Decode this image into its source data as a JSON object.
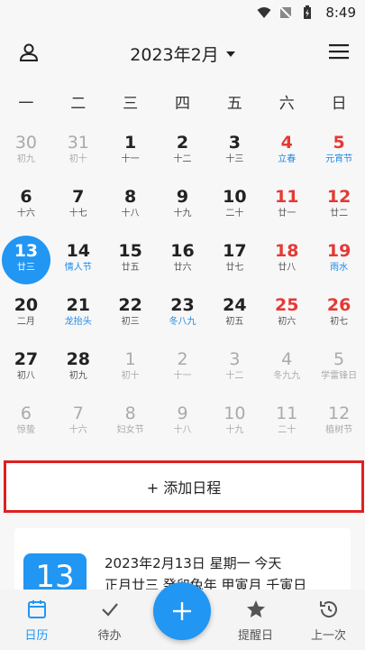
{
  "status": {
    "time": "8:49"
  },
  "header": {
    "title": "2023年2月"
  },
  "weekdays": [
    "一",
    "二",
    "三",
    "四",
    "五",
    "六",
    "日"
  ],
  "weeks": [
    [
      {
        "n": "30",
        "s": "初九",
        "t": "dim"
      },
      {
        "n": "31",
        "s": "初十",
        "t": "dim"
      },
      {
        "n": "1",
        "s": "十一",
        "t": ""
      },
      {
        "n": "2",
        "s": "十二",
        "t": ""
      },
      {
        "n": "3",
        "s": "十三",
        "t": ""
      },
      {
        "n": "4",
        "s": "立春",
        "t": "red blue"
      },
      {
        "n": "5",
        "s": "元宵节",
        "t": "red blue"
      }
    ],
    [
      {
        "n": "6",
        "s": "十六",
        "t": ""
      },
      {
        "n": "7",
        "s": "十七",
        "t": ""
      },
      {
        "n": "8",
        "s": "十八",
        "t": ""
      },
      {
        "n": "9",
        "s": "十九",
        "t": ""
      },
      {
        "n": "10",
        "s": "二十",
        "t": ""
      },
      {
        "n": "11",
        "s": "廿一",
        "t": "red"
      },
      {
        "n": "12",
        "s": "廿二",
        "t": "red"
      }
    ],
    [
      {
        "n": "13",
        "s": "廿三",
        "t": "today"
      },
      {
        "n": "14",
        "s": "情人节",
        "t": "blue"
      },
      {
        "n": "15",
        "s": "廿五",
        "t": ""
      },
      {
        "n": "16",
        "s": "廿六",
        "t": ""
      },
      {
        "n": "17",
        "s": "廿七",
        "t": ""
      },
      {
        "n": "18",
        "s": "廿八",
        "t": "red"
      },
      {
        "n": "19",
        "s": "雨水",
        "t": "red blue"
      }
    ],
    [
      {
        "n": "20",
        "s": "二月",
        "t": ""
      },
      {
        "n": "21",
        "s": "龙抬头",
        "t": "blue"
      },
      {
        "n": "22",
        "s": "初三",
        "t": ""
      },
      {
        "n": "23",
        "s": "冬八九",
        "t": "blue"
      },
      {
        "n": "24",
        "s": "初五",
        "t": ""
      },
      {
        "n": "25",
        "s": "初六",
        "t": "red"
      },
      {
        "n": "26",
        "s": "初七",
        "t": "red"
      }
    ],
    [
      {
        "n": "27",
        "s": "初八",
        "t": ""
      },
      {
        "n": "28",
        "s": "初九",
        "t": ""
      },
      {
        "n": "1",
        "s": "初十",
        "t": "dim"
      },
      {
        "n": "2",
        "s": "十一",
        "t": "dim"
      },
      {
        "n": "3",
        "s": "十二",
        "t": "dim"
      },
      {
        "n": "4",
        "s": "冬九九",
        "t": "dim"
      },
      {
        "n": "5",
        "s": "学雷锋日",
        "t": "dim"
      }
    ],
    [
      {
        "n": "6",
        "s": "惊蛰",
        "t": "dim"
      },
      {
        "n": "7",
        "s": "十六",
        "t": "dim"
      },
      {
        "n": "8",
        "s": "妇女节",
        "t": "dim"
      },
      {
        "n": "9",
        "s": "十八",
        "t": "dim"
      },
      {
        "n": "10",
        "s": "十九",
        "t": "dim"
      },
      {
        "n": "11",
        "s": "二十",
        "t": "dim"
      },
      {
        "n": "12",
        "s": "植树节",
        "t": "dim"
      }
    ]
  ],
  "add_button": {
    "label": "+ 添加日程"
  },
  "detail": {
    "day": "13",
    "line1": "2023年2月13日 星期一 今天",
    "line2": "正月廿三 癸卯兔年 甲寅月 壬寅日"
  },
  "nav": [
    {
      "label": "日历",
      "icon": "calendar-icon"
    },
    {
      "label": "待办",
      "icon": "check-icon"
    },
    {
      "label": "提醒日",
      "icon": "star-icon"
    },
    {
      "label": "上一次",
      "icon": "history-icon"
    }
  ],
  "colors": {
    "accent": "#2196f3",
    "holiday_red": "#e53935",
    "highlight_border": "#e02020"
  }
}
